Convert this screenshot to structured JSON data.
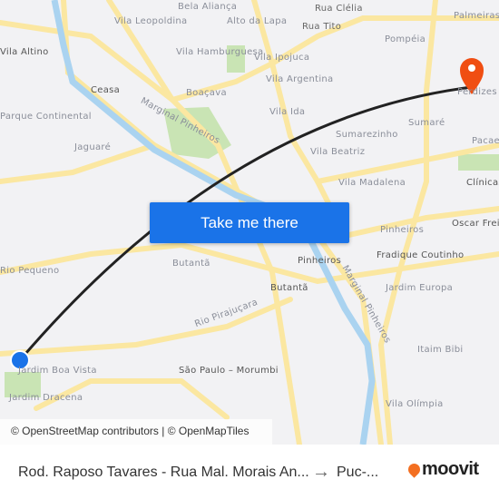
{
  "map": {
    "labels": [
      "Bela Aliança",
      "Vila Leopoldina",
      "Alto da Lapa",
      "Rua Clélia",
      "Rua Tito",
      "Pompéia",
      "Palmeiras Barra Funda",
      "Vila Hamburguesa",
      "Vila Ipojuca",
      "Vila Argentina",
      "Perdizes",
      "Ceasa",
      "Boaçava",
      "Vila Ida",
      "Sumaré",
      "Pacaembu",
      "Parque Continental",
      "Jaguaré",
      "Sumarezinho",
      "Vila Beatriz",
      "Vila Madalena",
      "Clínicas",
      "Oscar Freire",
      "Pinheiros",
      "Fradique Coutinho",
      "Pinheiros",
      "Butantã",
      "Butantã",
      "Jardim Europa",
      "Rio Pirajuçara",
      "Marginal Pinheiros",
      "Marginal Pinheiros",
      "Itaim Bibi",
      "São Paulo – Morumbi",
      "Jardim Boa Vista",
      "Jardim Dracena",
      "Vila Olímpia",
      "Rio Pequeno",
      "Vila Altino"
    ],
    "colors": {
      "road": "#fbe7a1",
      "river": "#aad3f0",
      "park": "#c9e4b4",
      "route": "#222222",
      "origin": "#1a73e8",
      "destination": "#f04e12"
    },
    "attribution": "© OpenStreetMap contributors | © OpenMapTiles"
  },
  "cta": {
    "label": "Take me there"
  },
  "footer": {
    "from": "Rod. Raposo Tavares - Rua Mal. Morais An...",
    "arrow": "→",
    "to": "Puc-...",
    "brand": "moovit"
  }
}
